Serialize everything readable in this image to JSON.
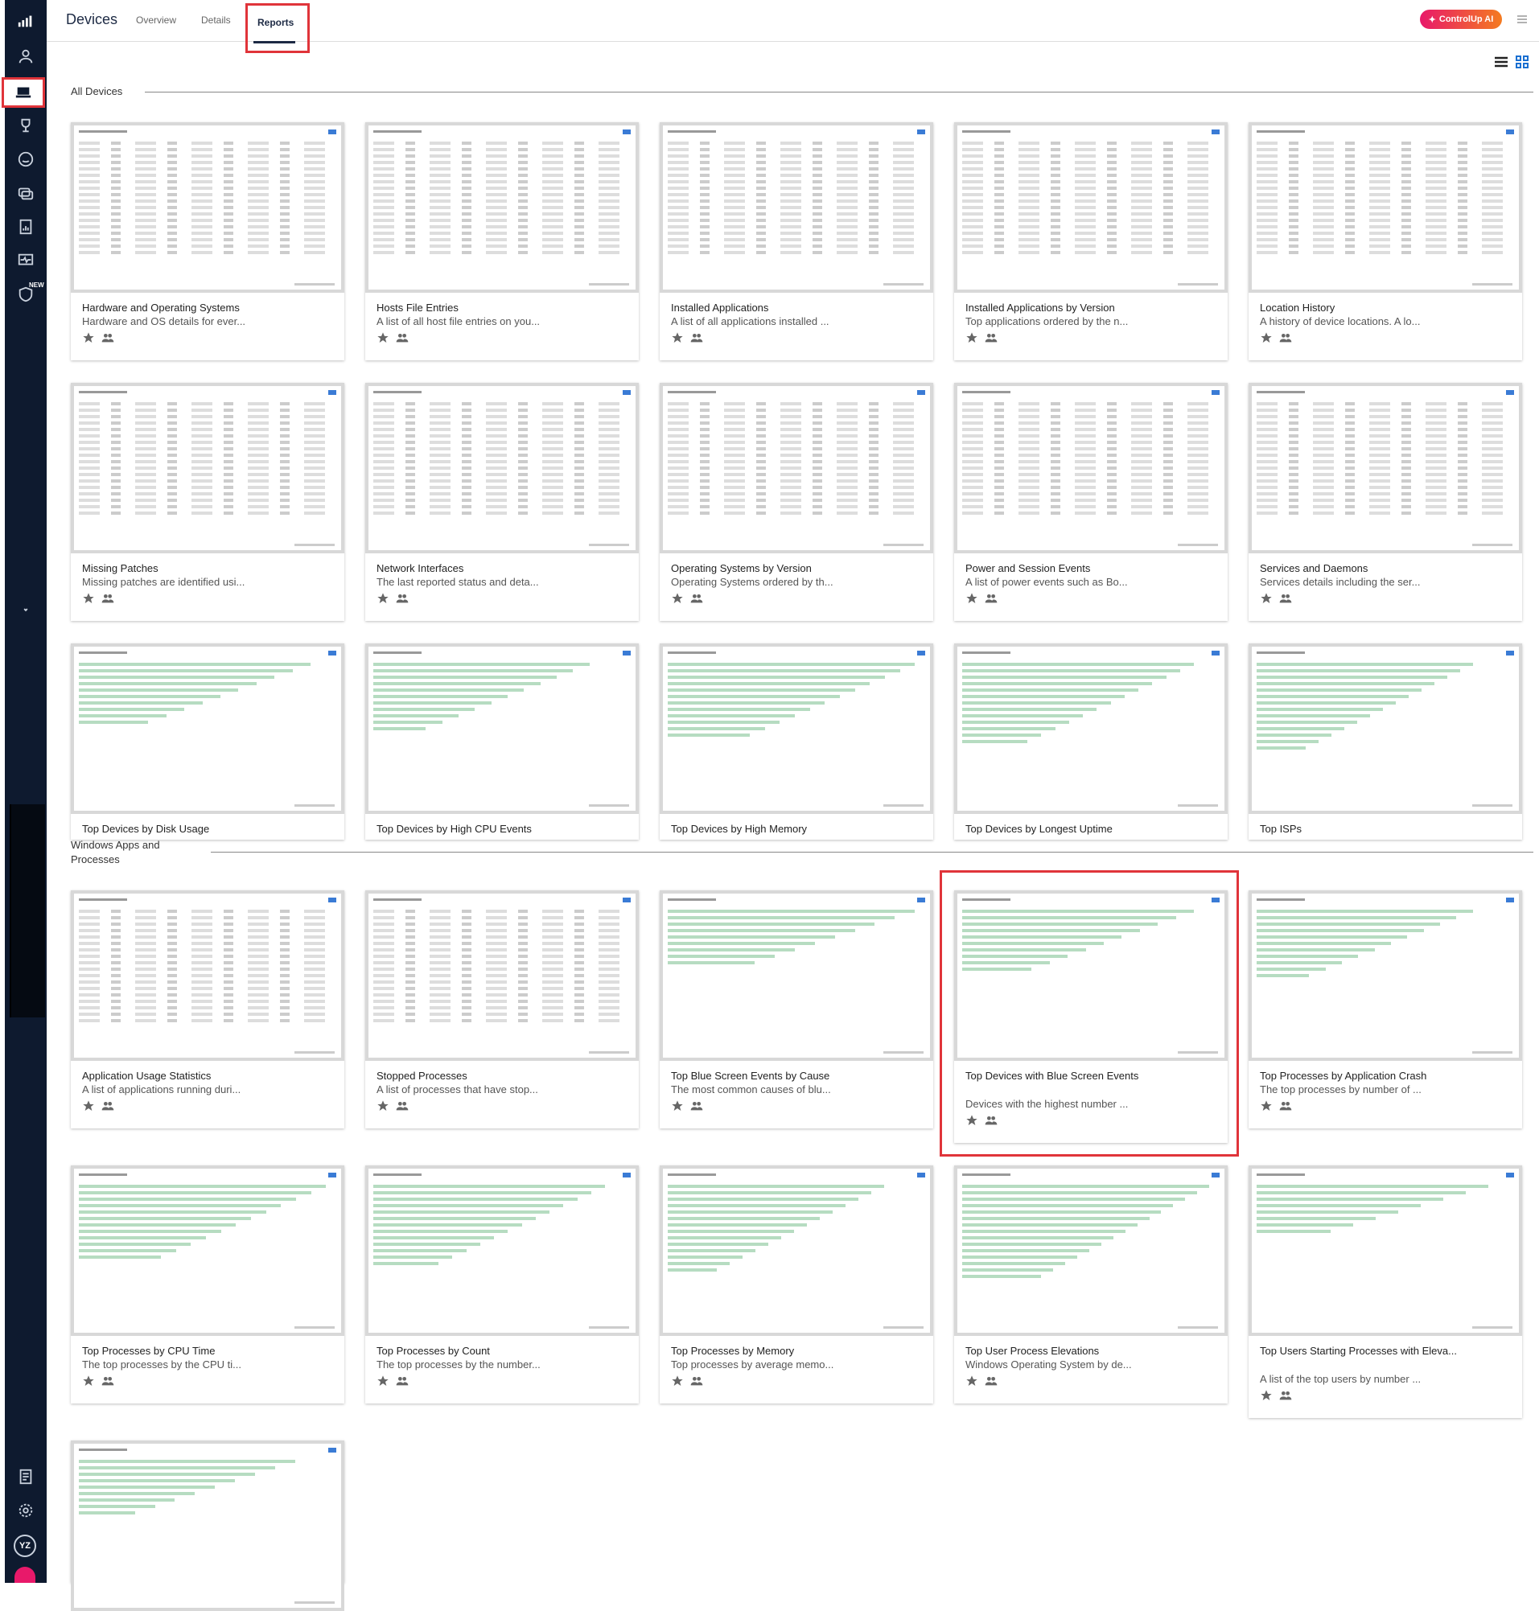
{
  "header": {
    "title": "Devices",
    "tabs": [
      "Overview",
      "Details",
      "Reports"
    ],
    "active_tab": "Reports",
    "ai_button": "ControlUp AI"
  },
  "sidebar": {
    "new_badge": "NEW",
    "avatar_initials": "YZ",
    "icons": [
      "logo-bars",
      "user",
      "devices",
      "trophy",
      "smile",
      "cloud-stack",
      "reports",
      "monitor-pulse",
      "shield",
      "chevron-down",
      "document",
      "settings"
    ]
  },
  "sections": [
    {
      "title": "All Devices",
      "cards": [
        {
          "title": "Hardware and Operating Systems",
          "desc": "Hardware and OS details for ever...",
          "kind": "table"
        },
        {
          "title": "Hosts File Entries",
          "desc": "A list of all host file entries on you...",
          "kind": "table"
        },
        {
          "title": "Installed Applications",
          "desc": "A list of all applications installed ...",
          "kind": "table"
        },
        {
          "title": "Installed Applications by Version",
          "desc": "Top applications ordered by the n...",
          "kind": "table"
        },
        {
          "title": "Location History",
          "desc": "A history of device locations. A lo...",
          "kind": "table"
        },
        {
          "title": "Missing Patches",
          "desc": "Missing patches are identified usi...",
          "kind": "table"
        },
        {
          "title": "Network Interfaces",
          "desc": "The last reported status and deta...",
          "kind": "table"
        },
        {
          "title": "Operating Systems by Version",
          "desc": "Operating Systems ordered by th...",
          "kind": "table"
        },
        {
          "title": "Power and Session Events",
          "desc": "A list of power events such as Bo...",
          "kind": "table"
        },
        {
          "title": "Services and Daemons",
          "desc": "Services details including the ser...",
          "kind": "table"
        },
        {
          "title": "Top Devices by Disk Usage",
          "desc": "",
          "kind": "bars"
        },
        {
          "title": "Top Devices by High CPU Events",
          "desc": "",
          "kind": "bars"
        },
        {
          "title": "Top Devices by High Memory",
          "desc": "",
          "kind": "bars"
        },
        {
          "title": "Top Devices by Longest Uptime",
          "desc": "",
          "kind": "bars"
        },
        {
          "title": "Top ISPs",
          "desc": "",
          "kind": "bars"
        }
      ]
    },
    {
      "title": "Windows Apps and Processes",
      "cards": [
        {
          "title": "Application Usage Statistics",
          "desc": "A list of applications running duri...",
          "kind": "table"
        },
        {
          "title": "Stopped Processes",
          "desc": "A list of processes that have stop...",
          "kind": "table"
        },
        {
          "title": "Top Blue Screen Events by Cause",
          "desc": "The most common causes of blu...",
          "kind": "bars"
        },
        {
          "title": "Top Devices with Blue Screen Events",
          "desc": "Devices with the highest number ...",
          "kind": "bars"
        },
        {
          "title": "Top Processes by Application Crash",
          "desc": "The top processes by number of ...",
          "kind": "bars"
        },
        {
          "title": "Top Processes by CPU Time",
          "desc": "The top processes by the CPU ti...",
          "kind": "bars"
        },
        {
          "title": "Top Processes by Count",
          "desc": "The top processes by the number...",
          "kind": "bars"
        },
        {
          "title": "Top Processes by Memory",
          "desc": "Top processes by average memo...",
          "kind": "bars"
        },
        {
          "title": "Top User Process Elevations",
          "desc": "Windows Operating System by de...",
          "kind": "bars"
        },
        {
          "title": "Top Users Starting Processes with Eleva...",
          "desc": "A list of the top users by number ...",
          "kind": "bars"
        },
        {
          "title": "",
          "desc": "",
          "kind": "bars"
        }
      ]
    }
  ],
  "colors": {
    "accent_red": "#e0343a",
    "sidebar_bg": "#0e1a2f",
    "bar_green": "#b6dcc1"
  }
}
